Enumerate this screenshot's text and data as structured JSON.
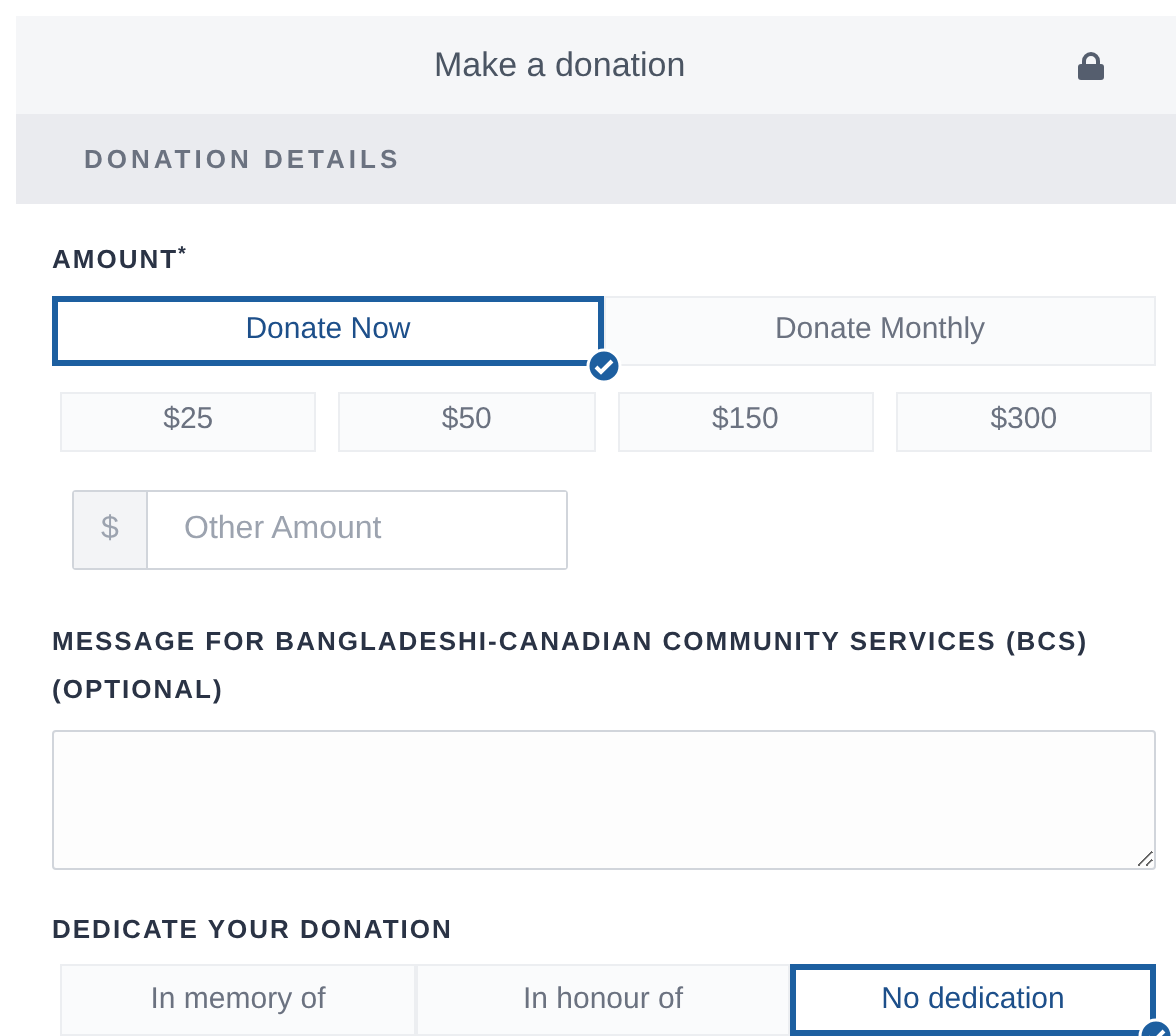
{
  "header": {
    "title": "Make a donation"
  },
  "section": {
    "title": "DONATION DETAILS"
  },
  "amount": {
    "label": "AMOUNT",
    "required_mark": "*",
    "frequencies": [
      {
        "label": "Donate Now",
        "selected": true
      },
      {
        "label": "Donate Monthly",
        "selected": false
      }
    ],
    "presets": [
      {
        "label": "$25",
        "selected": false
      },
      {
        "label": "$50",
        "selected": false
      },
      {
        "label": "$150",
        "selected": false
      },
      {
        "label": "$300",
        "selected": false
      }
    ],
    "other": {
      "prefix": "$",
      "placeholder": "Other Amount"
    }
  },
  "message": {
    "label": "MESSAGE FOR BANGLADESHI-CANADIAN COMMUNITY SERVICES (BCS) (OPTIONAL)"
  },
  "dedication": {
    "label": "DEDICATE YOUR DONATION",
    "options": [
      {
        "label": "In memory of",
        "selected": false
      },
      {
        "label": "In honour of",
        "selected": false
      },
      {
        "label": "No dedication",
        "selected": true
      }
    ]
  }
}
